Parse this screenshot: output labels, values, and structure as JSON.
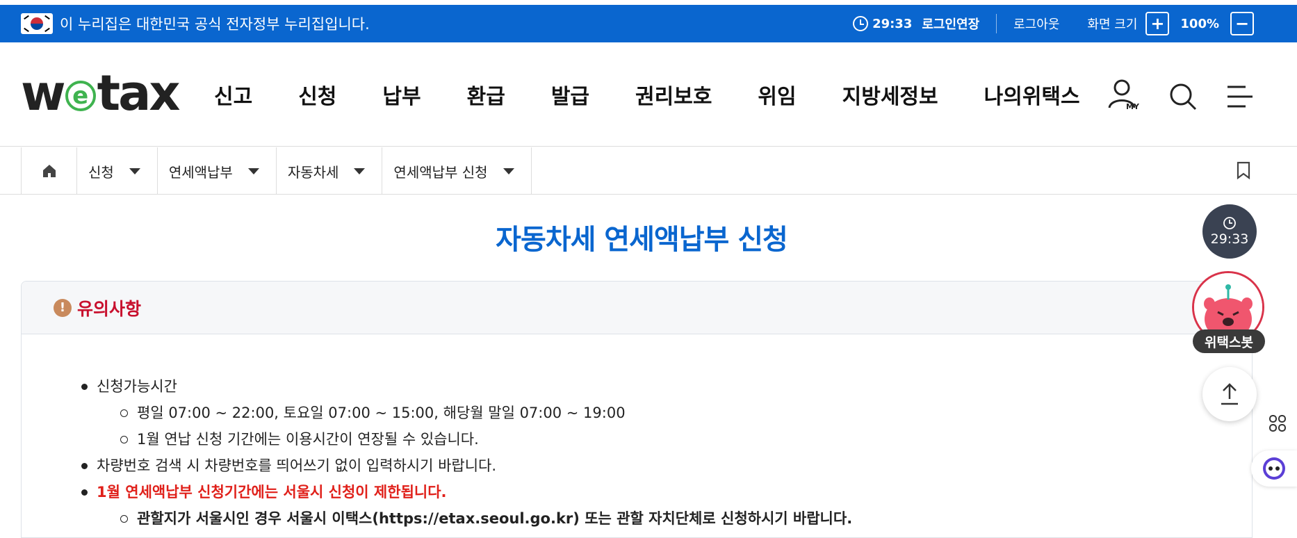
{
  "gov_bar": {
    "notice": "이 누리집은 대한민국 공식 전자정부 누리집입니다.",
    "timer": "29:33",
    "extend_label": "로그인연장",
    "logout_label": "로그아웃",
    "zoom_label": "화면 크기",
    "zoom_in": "+",
    "zoom_value": "100%",
    "zoom_out": "−"
  },
  "header": {
    "logo_pre": "w",
    "logo_e": "e",
    "logo_post": "tax",
    "nav": [
      "신고",
      "신청",
      "납부",
      "환급",
      "발급",
      "권리보호",
      "위임",
      "지방세정보",
      "나의위택스"
    ],
    "my_label": "MY"
  },
  "breadcrumb": [
    "신청",
    "연세액납부",
    "자동차세",
    "연세액납부 신청"
  ],
  "page": {
    "title": "자동차세 연세액납부 신청"
  },
  "notice": {
    "title": "유의사항",
    "icon_mark": "!",
    "items": {
      "hours": "신청가능시간",
      "hours_detail": "평일 07:00 ~ 22:00, 토요일 07:00 ~ 15:00, 해당월 말일 07:00 ~ 19:00",
      "hours_extend": "1월 연납 신청 기간에는 이용시간이 연장될 수 있습니다.",
      "plate": "차량번호 검색 시 차량번호를 띄어쓰기 없이 입력하시기 바랍니다.",
      "seoul_limit": "1월 연세액납부 신청기간에는 서울시 신청이 제한됩니다.",
      "seoul_guide": "관할지가 서울시인 경우 서울시 이택스(https://etax.seoul.go.kr) 또는 관할 자치단체로 신청하시기 바랍니다."
    }
  },
  "floating": {
    "timer": "29:33",
    "bot_label": "위택스봇"
  },
  "colors": {
    "gov_blue": "#0a66cf",
    "title_blue": "#0a66cf",
    "notice_red": "#c8102e",
    "alert_red": "#e0201a",
    "logo_green": "#3fb34f"
  }
}
